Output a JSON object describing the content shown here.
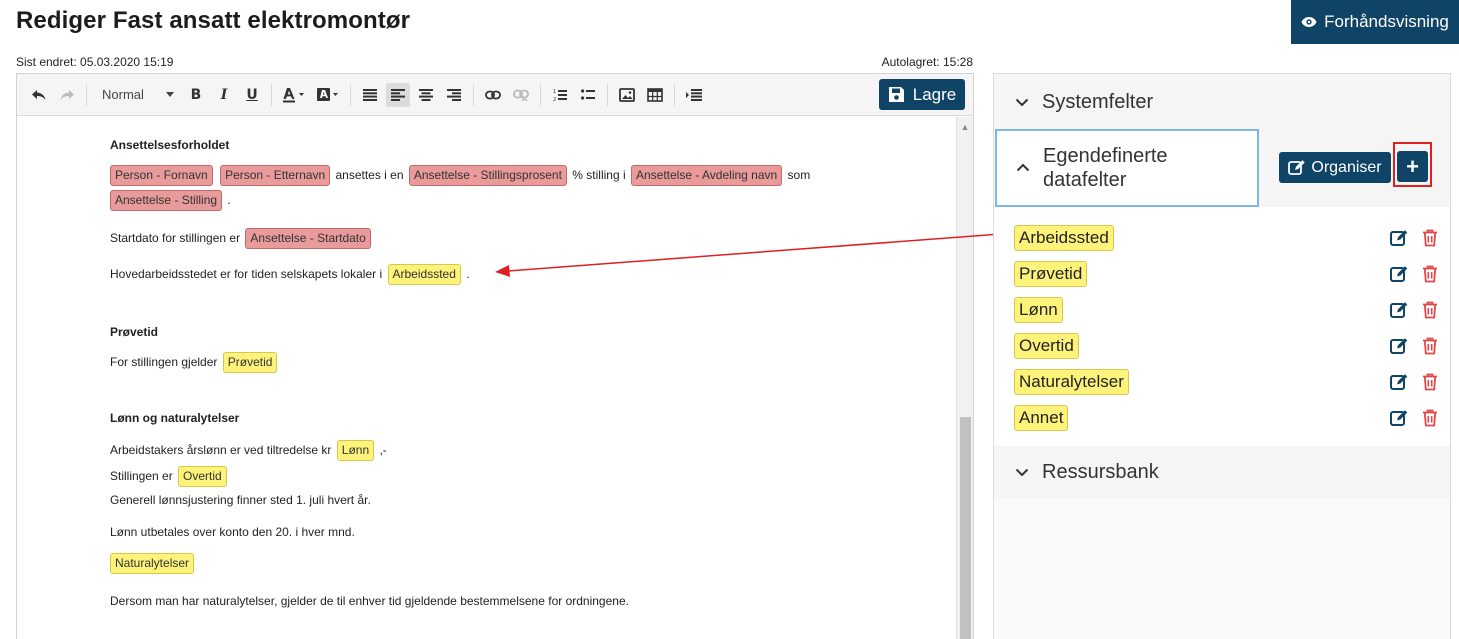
{
  "header": {
    "title": "Rediger Fast ansatt elektromontør",
    "preview_label": "Forhåndsvisning",
    "last_changed": "Sist endret: 05.03.2020 15:19",
    "autosaved": "Autolagret: 15:28"
  },
  "toolbar": {
    "style_select": "Normal",
    "bold": "B",
    "italic": "I",
    "underline": "U",
    "save_label": "Lagre"
  },
  "document": {
    "sec1_heading": "Ansettelsesforholdet",
    "p1": {
      "tag_firstname": "Person - Fornavn",
      "tag_lastname": "Person - Etternavn",
      "text_a": "ansettes i en",
      "tag_percent": "Ansettelse - Stillingsprosent",
      "text_b": "% stilling i",
      "tag_department": "Ansettelse - Avdeling navn",
      "text_c": "som",
      "tag_position": "Ansettelse - Stilling",
      "text_d": "."
    },
    "p2": {
      "text": "Startdato for stillingen er",
      "tag": "Ansettelse - Startdato"
    },
    "p3": {
      "text": "Hovedarbeidsstedet er for tiden selskapets lokaler i",
      "tag": "Arbeidssted",
      "end": "."
    },
    "sec2_heading": "Prøvetid",
    "p4": {
      "text": "For stillingen gjelder",
      "tag": "Prøvetid"
    },
    "sec3_heading": "Lønn og naturalytelser",
    "p5": {
      "text": "Arbeidstakers årslønn er ved tiltredelse kr",
      "tag": "Lønn",
      "end": ",-"
    },
    "p6": {
      "text": "Stillingen er",
      "tag": "Overtid"
    },
    "p7": "Generell lønnsjustering finner sted 1. juli hvert år.",
    "p8": "Lønn utbetales over konto den 20. i hver mnd.",
    "p9_tag": "Naturalytelser",
    "p10": "Dersom man har naturalytelser, gjelder de til enhver tid gjeldende bestemmelsene for ordningene."
  },
  "panel": {
    "system_fields": "Systemfelter",
    "custom_fields_line1": "Egendefinerte",
    "custom_fields_line2": "datafelter",
    "organise_label": "Organiser",
    "add_label": "+",
    "fields": [
      {
        "label": "Arbeidssted"
      },
      {
        "label": "Prøvetid"
      },
      {
        "label": "Lønn"
      },
      {
        "label": "Overtid"
      },
      {
        "label": "Naturalytelser"
      },
      {
        "label": "Annet"
      }
    ],
    "resource_bank": "Ressursbank"
  },
  "colors": {
    "primary": "#0f4466",
    "field_tag": "#fdf37a",
    "system_tag": "#e99a9a",
    "delete": "#e04848",
    "highlight": "#e02020",
    "focus_border": "#7cb7e6"
  },
  "icons": [
    "eye-icon",
    "undo-icon",
    "redo-icon",
    "save-icon",
    "edit-icon",
    "trash-icon",
    "chevron-down-icon",
    "chevron-up-icon"
  ]
}
